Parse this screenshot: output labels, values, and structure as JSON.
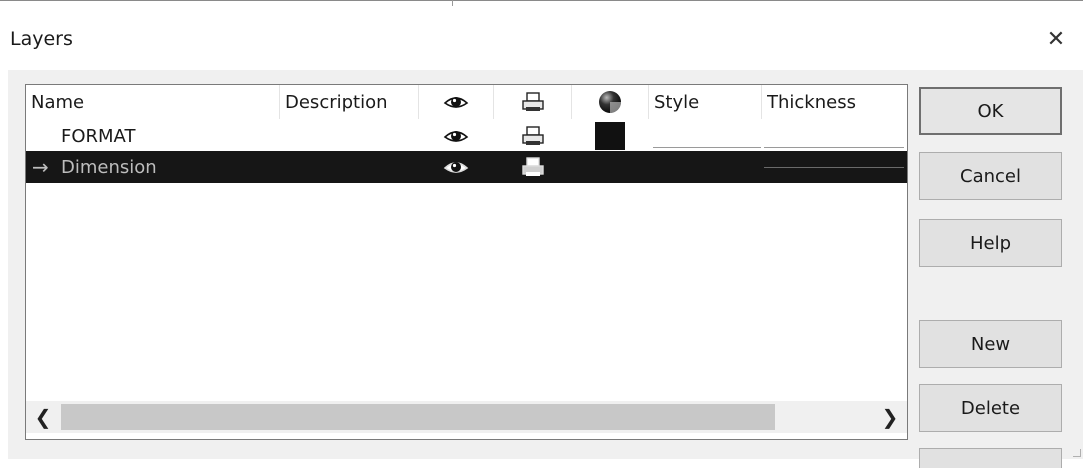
{
  "window": {
    "title": "Layers",
    "close_glyph": "✕"
  },
  "layer_list": {
    "columns": {
      "name": "Name",
      "description": "Description",
      "visible_icon": "eye-icon",
      "print_icon": "printer-icon",
      "color_icon": "color-sphere-icon",
      "style": "Style",
      "thickness": "Thickness"
    },
    "rows": [
      {
        "current_marker": "",
        "name": "FORMAT",
        "description": "",
        "visible": true,
        "printable": true,
        "color": "#111111",
        "selected": false
      },
      {
        "current_marker": "→",
        "name": "Dimension",
        "description": "",
        "visible": true,
        "printable": true,
        "color": "",
        "selected": true
      }
    ],
    "scroll_left_glyph": "❮",
    "scroll_right_glyph": "❯"
  },
  "buttons": {
    "ok": "OK",
    "cancel": "Cancel",
    "help": "Help",
    "new": "New",
    "delete": "Delete"
  },
  "colors": {
    "selection_background": "#161616",
    "dialog_background": "#f0f0f0",
    "button_face": "#e1e1e1"
  }
}
